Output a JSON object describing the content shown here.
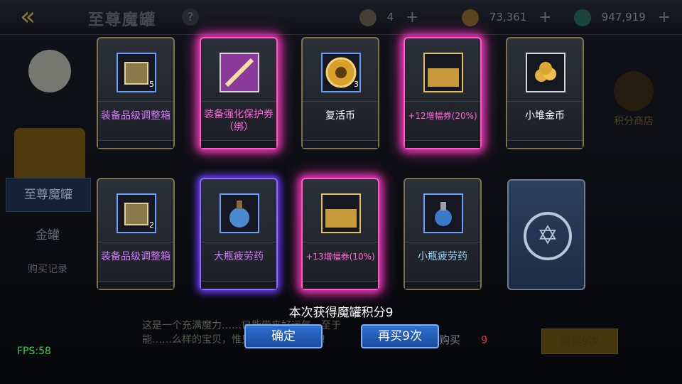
{
  "header": {
    "title": "至尊魔罐",
    "help": "?",
    "back": "«",
    "resources": [
      {
        "icon": "stamina-icon",
        "value": "4",
        "color": "#a89a78"
      },
      {
        "icon": "gold-coin-icon",
        "value": "73,361",
        "color": "#c79a3a"
      },
      {
        "icon": "gem-icon",
        "value": "947,919",
        "color": "#2b9c7a"
      }
    ]
  },
  "sidebar": {
    "tabs": [
      "至尊魔罐",
      "金罐",
      "购买记录"
    ]
  },
  "shop": {
    "label": "积分商店"
  },
  "description": "这是一个充满魔力……已能带来好运气，至于能……么样的宝贝，惟只有打开它才知道！",
  "fps": "FPS:58",
  "rewards": [
    {
      "name": "装备品级调整箱",
      "count": "5",
      "icon": "equipment-box-icon",
      "glow": false,
      "text_class": "purpletext",
      "icon_class": "blue"
    },
    {
      "name": "装备强化保护券（绑）",
      "count": "",
      "icon": "protect-scroll-icon",
      "glow": true,
      "text_class": "pinktext",
      "icon_class": "white"
    },
    {
      "name": "复活币",
      "count": "3",
      "icon": "revive-coin-icon",
      "glow": false,
      "text_class": "whitetext",
      "icon_class": "blue"
    },
    {
      "name": "+12增幅券(20%)",
      "count": "",
      "icon": "amplify-12-icon",
      "glow": true,
      "text_class": "pinktext",
      "icon_class": "gold"
    },
    {
      "name": "小堆金币",
      "count": "",
      "icon": "gold-pile-icon",
      "glow": false,
      "text_class": "whitetext",
      "icon_class": "white"
    },
    {
      "name": "装备品级调整箱",
      "count": "2",
      "icon": "equipment-box-icon",
      "glow": false,
      "text_class": "purpletext",
      "icon_class": "blue"
    },
    {
      "name": "大瓶疲劳药",
      "count": "",
      "icon": "large-potion-icon",
      "glow": false,
      "text_class": "purpletext",
      "icon_class": "blue"
    },
    {
      "name": "+13增幅券(10%)",
      "count": "",
      "icon": "amplify-13-icon",
      "glow": true,
      "text_class": "pinktext",
      "icon_class": "gold"
    },
    {
      "name": "小瓶疲劳药",
      "count": "",
      "icon": "small-potion-icon",
      "glow": false,
      "text_class": "bluetext",
      "icon_class": "blue"
    }
  ],
  "result": {
    "points_text": "本次获得魔罐积分9",
    "confirm_label": "确定",
    "buy_again_label": "再买9次",
    "buy9_label": "购买9次",
    "buy1_label": "购买",
    "buy_count": "9"
  }
}
